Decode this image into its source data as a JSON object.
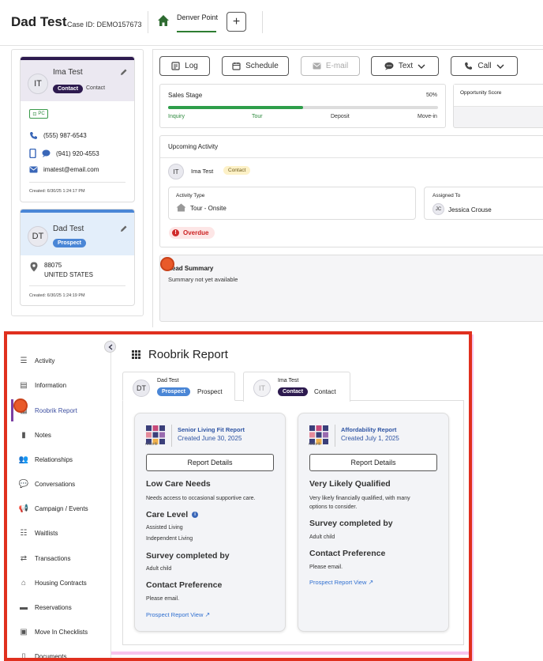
{
  "header": {
    "title": "Dad Test",
    "case_id": "Case ID: DEMO157673",
    "tab_label": "Denver Point",
    "add_label": "+"
  },
  "contacts": [
    {
      "initials": "IT",
      "name": "Ima Test",
      "badge": "Contact",
      "role": "Contact",
      "tag": "PC",
      "phone1": "(555) 987-6543",
      "phone2": "(941) 920-4553",
      "email": "imatest@email.com",
      "created": "Created: 6/30/25 1:24:17 PM"
    },
    {
      "initials": "DT",
      "name": "Dad Test",
      "badge": "Prospect",
      "zip": "88075",
      "country": "UNITED STATES",
      "created": "Created: 6/30/25 1:24:19 PM"
    }
  ],
  "actions": {
    "log": "Log",
    "schedule": "Schedule",
    "email": "E-mail",
    "text": "Text",
    "call": "Call"
  },
  "sales_stage": {
    "title": "Sales Stage",
    "percent_label": "50%",
    "progress": 0.5,
    "stages": [
      "Inquiry",
      "Tour",
      "Deposit",
      "Move-in"
    ]
  },
  "opportunity_score": {
    "title": "Opportunity Score"
  },
  "upcoming": {
    "title": "Upcoming Activity",
    "initials": "IT",
    "name": "Ima Test",
    "badge": "Contact",
    "activity_type_label": "Activity Type",
    "activity_type": "Tour - Onsite",
    "assigned_label": "Assigned To",
    "assigned_initials": "JC",
    "assigned_name": "Jessica Crouse",
    "status": "Overdue"
  },
  "lead_summary": {
    "title": "Lead Summary",
    "text": "Summary not yet available"
  },
  "nav": {
    "items": [
      "Activity",
      "Information",
      "Roobrik Report",
      "Notes",
      "Relationships",
      "Conversations",
      "Campaign / Events",
      "Waitlists",
      "Transactions",
      "Housing Contracts",
      "Reservations",
      "Move In Checklists",
      "Documents"
    ]
  },
  "report": {
    "title": "Roobrik Report",
    "tabs": [
      {
        "initials": "DT",
        "name": "Dad Test",
        "badge": "Prospect",
        "role": "Prospect"
      },
      {
        "initials": "IT",
        "name": "Ima Test",
        "badge": "Contact",
        "role": "Contact"
      }
    ],
    "logo_text": "roobrik",
    "cards": [
      {
        "title": "Senior Living Fit Report",
        "date": "Created June 30, 2025",
        "button": "Report Details",
        "h1": "Low Care Needs",
        "t1": "Needs access to occasional supportive care.",
        "h2": "Care Level",
        "t2a": "Assisted Living",
        "t2b": "Independent Living",
        "h3": "Survey completed by",
        "t3": "Adult child",
        "h4": "Contact Preference",
        "t4": "Please email.",
        "link": "Prospect Report View"
      },
      {
        "title": "Affordability Report",
        "date": "Created July 1, 2025",
        "button": "Report Details",
        "h1": "Very Likely Qualified",
        "t1a": "Very likely financially qualified, with many",
        "t1b": "options to consider.",
        "h2": "Survey completed by",
        "t2": "Adult child",
        "h3": "Contact Preference",
        "t3": "Please email.",
        "link": "Prospect Report View"
      }
    ]
  },
  "colors": {
    "brand_green": "#2e7d32",
    "contact_badge": "#2d1a4f",
    "prospect_badge": "#4a86d6",
    "highlight": "#e0301e",
    "link": "#2f6fd0"
  }
}
